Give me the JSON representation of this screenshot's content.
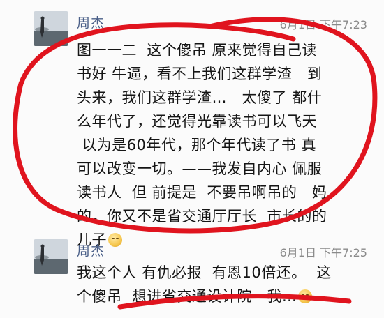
{
  "messages": [
    {
      "sender": "周杰",
      "time": "6月1日 下午7:23",
      "text": "图一一二  这个傻吊 原来觉得自己读\n书好 牛逼，看不上我们这群学渣   到\n头来，我们这群学渣…   太傻了 都什\n么年代了，还觉得光靠读书可以飞天\n 以为是60年代，那个年代读了书 真\n可以改变一切。——我发自内心 佩服\n读书人  但 前提是  不要吊啊吊的   妈\n的，你又不是省交通厅厅长  市长的的\n儿子",
      "emoji": "grimace-emoji"
    },
    {
      "sender": "周杰",
      "time": "6月1日 下午7:25",
      "text": "我这个人 有仇必报  有恩10倍还。  这\n个傻吊  想进省交通设计院   我…",
      "emoji": "grimace-emoji"
    }
  ],
  "colors": {
    "sender": "#4a5f88",
    "annotation": "#e0141e",
    "background": "#fbfbfb"
  }
}
